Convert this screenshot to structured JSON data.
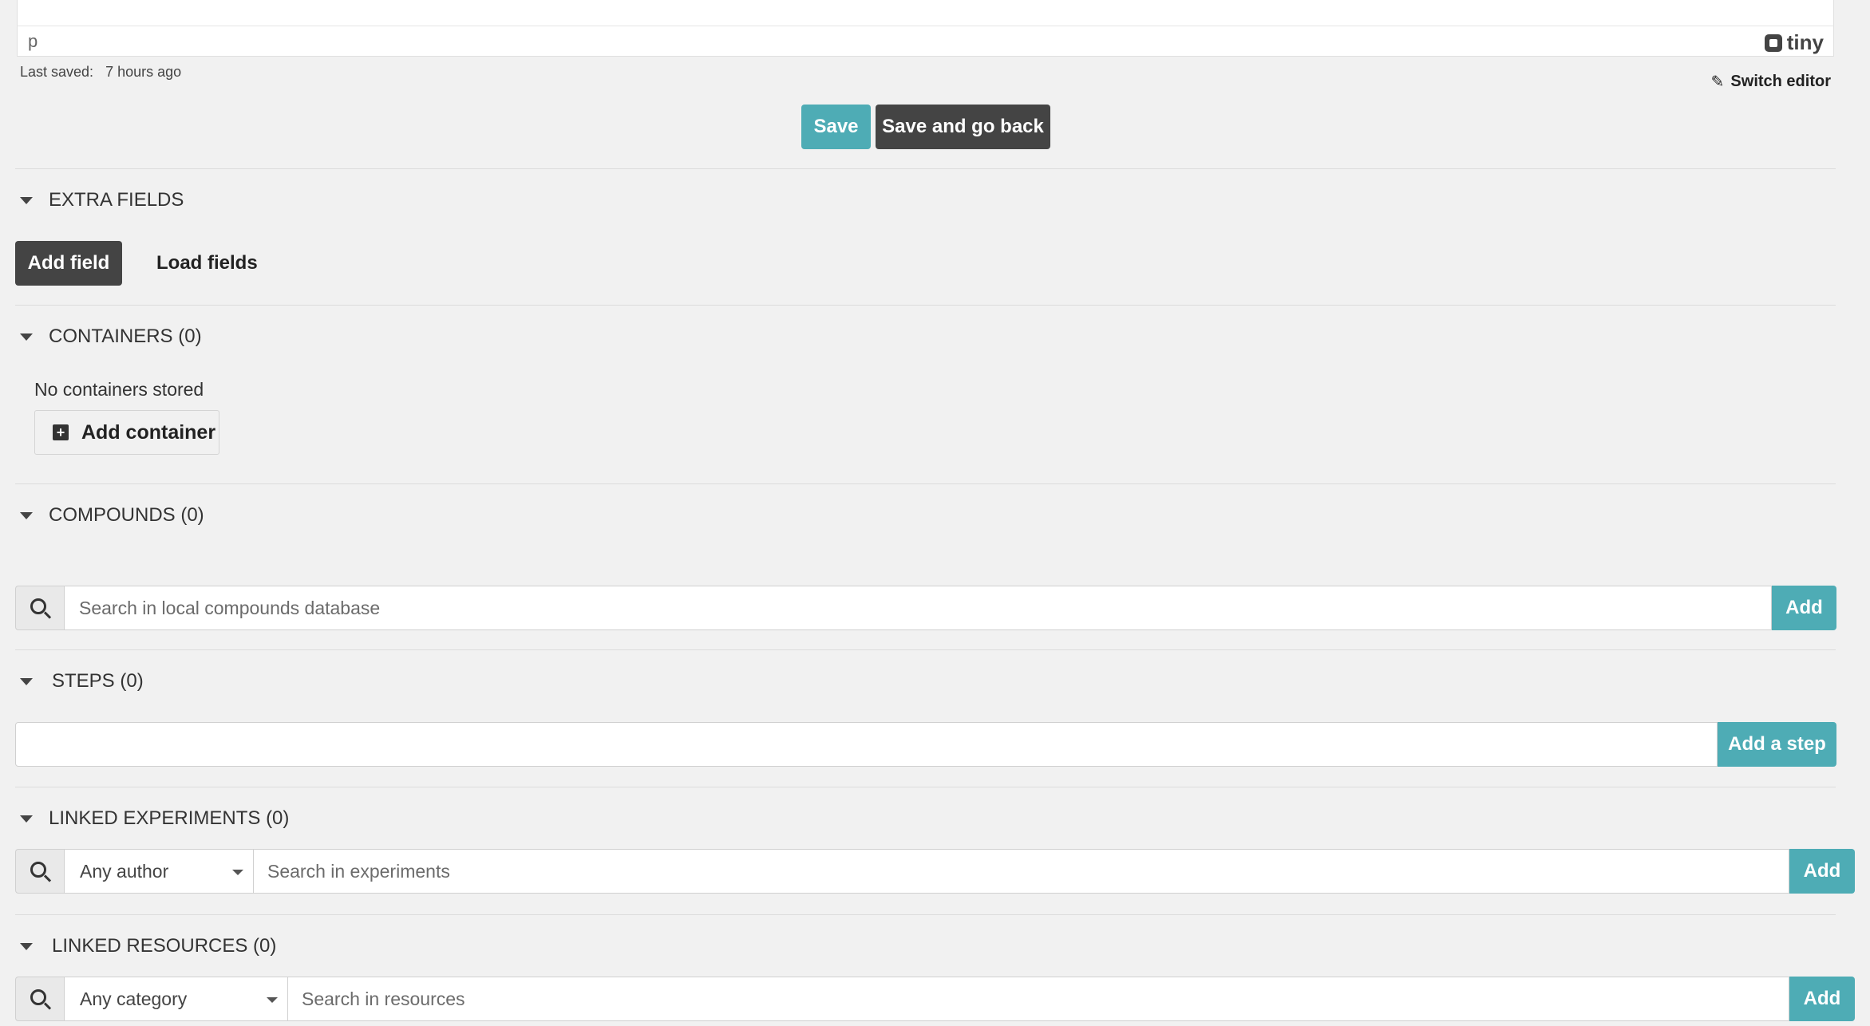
{
  "editor": {
    "status_path": "p",
    "brand": "tiny",
    "last_saved_label": "Last saved:",
    "last_saved_value": "7 hours ago",
    "switch_editor": "Switch editor"
  },
  "actions": {
    "save": "Save",
    "save_and_go_back": "Save and go back"
  },
  "extra_fields": {
    "title": "EXTRA FIELDS",
    "add_field": "Add field",
    "load_fields": "Load fields"
  },
  "containers": {
    "title": "CONTAINERS (0)",
    "empty_text": "No containers stored",
    "add_container": "Add container"
  },
  "compounds": {
    "title": "COMPOUNDS (0)",
    "search_placeholder": "Search in local compounds database",
    "add": "Add"
  },
  "steps": {
    "title": "STEPS (0)",
    "input_value": "",
    "add": "Add a step"
  },
  "linked_experiments": {
    "title": "LINKED EXPERIMENTS (0)",
    "author_select": "Any author",
    "search_placeholder": "Search in experiments",
    "add": "Add"
  },
  "linked_resources": {
    "title": "LINKED RESOURCES (0)",
    "category_select": "Any category",
    "search_placeholder": "Search in resources",
    "add": "Add"
  },
  "colors": {
    "accent": "#4eacb5",
    "dark_button": "#444444",
    "background": "#f1f1f1"
  }
}
